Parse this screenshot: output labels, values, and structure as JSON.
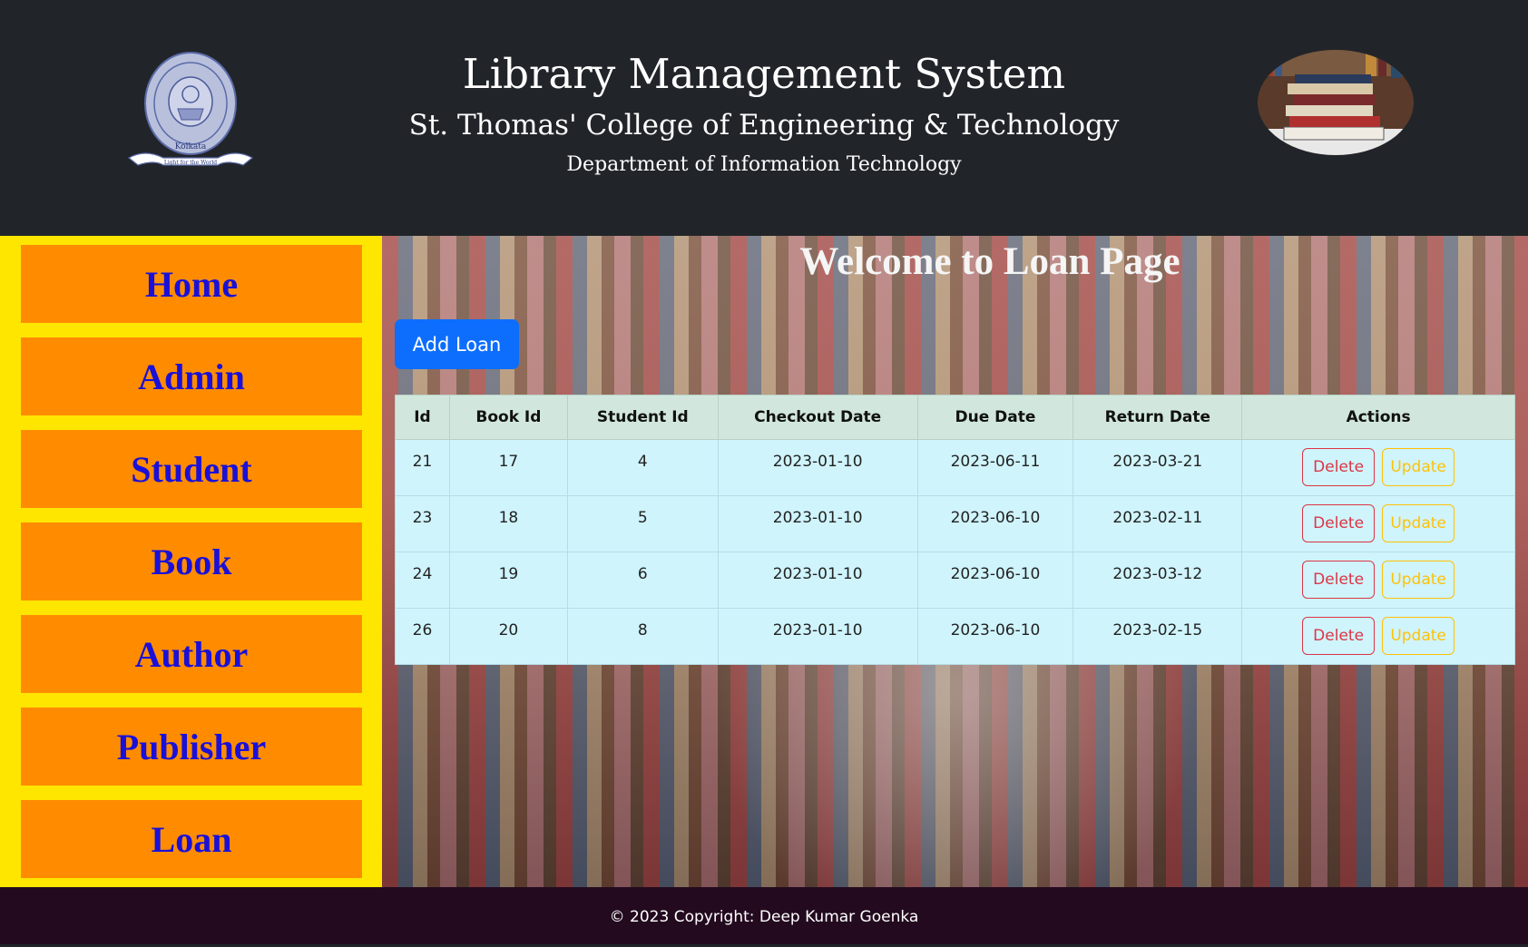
{
  "header": {
    "title": "Library Management System",
    "college": "St. Thomas' College of Engineering & Technology",
    "department": "Department of Information Technology",
    "logo_ring_text": "St. Thomas' College of Engineering & Technology",
    "logo_city": "Kolkata",
    "logo_motto": "Light for the World"
  },
  "sidebar": {
    "items": [
      {
        "label": "Home"
      },
      {
        "label": "Admin"
      },
      {
        "label": "Student"
      },
      {
        "label": "Book"
      },
      {
        "label": "Author"
      },
      {
        "label": "Publisher"
      },
      {
        "label": "Loan"
      }
    ]
  },
  "main": {
    "welcome": "Welcome to Loan Page",
    "add_button": "Add Loan",
    "table": {
      "headers": [
        "Id",
        "Book Id",
        "Student Id",
        "Checkout Date",
        "Due Date",
        "Return Date",
        "Actions"
      ],
      "rows": [
        [
          "21",
          "17",
          "4",
          "2023-01-10",
          "2023-06-11",
          "2023-03-21"
        ],
        [
          "23",
          "18",
          "5",
          "2023-01-10",
          "2023-06-10",
          "2023-02-11"
        ],
        [
          "24",
          "19",
          "6",
          "2023-01-10",
          "2023-06-10",
          "2023-03-12"
        ],
        [
          "26",
          "20",
          "8",
          "2023-01-10",
          "2023-06-10",
          "2023-02-15"
        ]
      ],
      "delete_label": "Delete",
      "update_label": "Update"
    }
  },
  "footer": {
    "text": "© 2023 Copyright: Deep Kumar Goenka"
  },
  "colors": {
    "header_bg": "#212529",
    "sidebar_bg": "#ffe600",
    "nav_bg": "#ff8c00",
    "nav_text": "#1a10d8",
    "primary": "#0d6efd",
    "danger": "#dc3545",
    "warning": "#ffc107",
    "footer_bg": "#230a1f"
  }
}
